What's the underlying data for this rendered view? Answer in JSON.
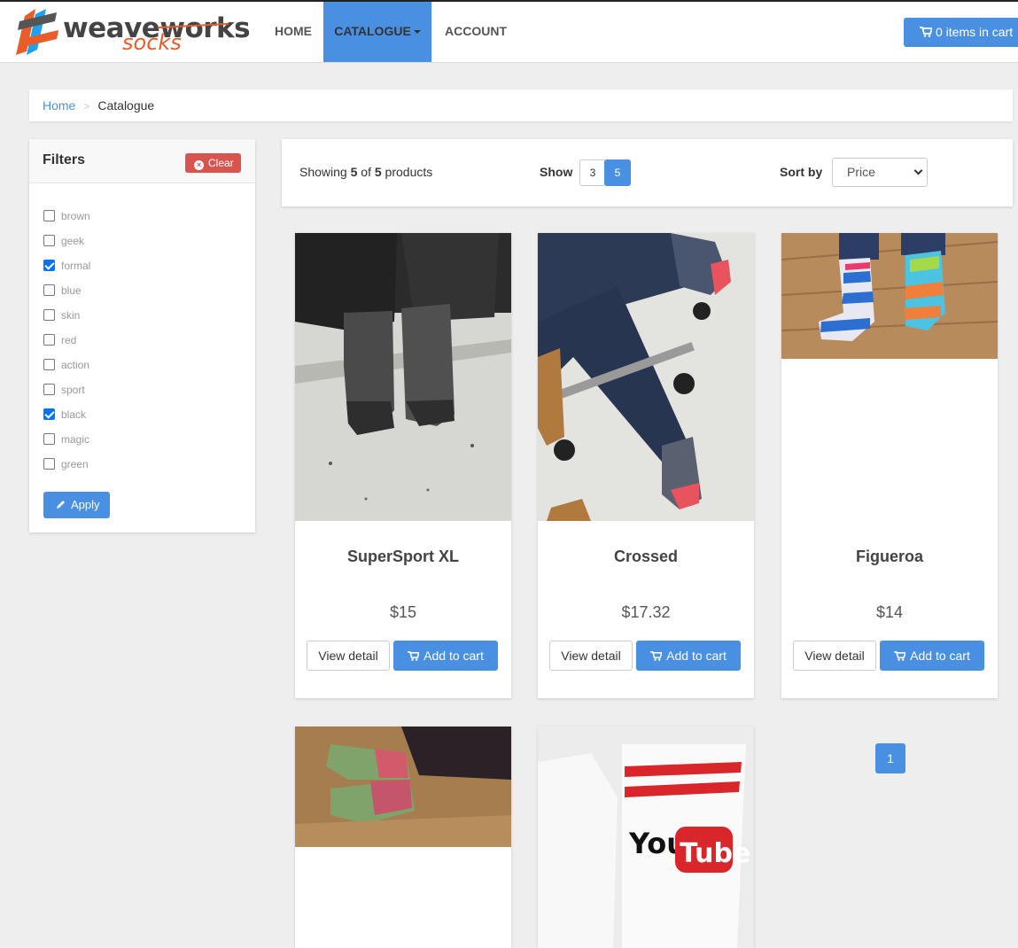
{
  "brand": {
    "name_part1": "weaveworks",
    "name_part2": "socks"
  },
  "nav": {
    "home": "HOME",
    "catalogue": "CATALOGUE",
    "account": "ACCOUNT",
    "cart": "0 items in cart"
  },
  "breadcrumb": {
    "home": "Home",
    "current": "Catalogue"
  },
  "filters": {
    "title": "Filters",
    "clear": "Clear",
    "apply": "Apply",
    "items": [
      {
        "label": "brown",
        "checked": false
      },
      {
        "label": "geek",
        "checked": false
      },
      {
        "label": "formal",
        "checked": true
      },
      {
        "label": "blue",
        "checked": false
      },
      {
        "label": "skin",
        "checked": false
      },
      {
        "label": "red",
        "checked": false
      },
      {
        "label": "action",
        "checked": false
      },
      {
        "label": "sport",
        "checked": false
      },
      {
        "label": "black",
        "checked": true
      },
      {
        "label": "magic",
        "checked": false
      },
      {
        "label": "green",
        "checked": false
      }
    ]
  },
  "results": {
    "showing_prefix": "Showing",
    "shown": "5",
    "of": "of",
    "total": "5",
    "products": "products",
    "show_label": "Show",
    "show_options": [
      "3",
      "5"
    ],
    "show_selected": "5",
    "sort_label": "Sort by",
    "sort_value": "Price"
  },
  "products": [
    {
      "name": "SuperSport XL",
      "price": "$15",
      "image": "grey-sport-socks"
    },
    {
      "name": "Crossed",
      "price": "$17.32",
      "image": "patterned-socks-chair"
    },
    {
      "name": "Figueroa",
      "price": "$14",
      "image": "striped-monster-socks"
    },
    {
      "name": "",
      "price": "",
      "image": "colorful-socks"
    },
    {
      "name": "",
      "price": "",
      "image": "youtube-socks"
    }
  ],
  "buttons": {
    "view_detail": "View detail",
    "add_to_cart": "Add to cart"
  },
  "pagination": {
    "current": "1"
  },
  "colors": {
    "accent": "#4a90e2",
    "danger": "#d9534f",
    "brand_orange": "#e85d2a"
  }
}
